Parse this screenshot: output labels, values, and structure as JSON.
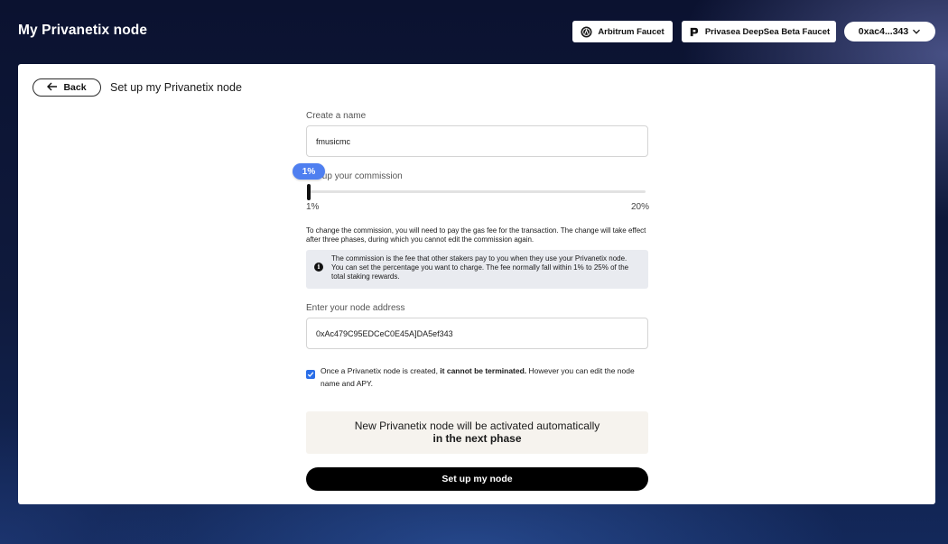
{
  "header": {
    "title": "My Privanetix node",
    "faucets": [
      {
        "label": "Arbitrum Faucet",
        "icon": "arbitrum-logo-icon"
      },
      {
        "label": "Privasea DeepSea Beta Faucet",
        "icon": "privasea-logo-icon"
      }
    ],
    "wallet": {
      "address": "0xac4...343",
      "icon": "chevron-down-icon"
    }
  },
  "card": {
    "back_label": "Back",
    "heading": "Set up my Privanetix node"
  },
  "form": {
    "name": {
      "label": "Create a name",
      "value": "fmusicmc"
    },
    "commission": {
      "label": "Set up your commission",
      "current": "1%",
      "current_value": 1,
      "min_label": "1%",
      "max_label": "20%",
      "min": 1,
      "max": 20
    },
    "commission_note": "To change the commission, you will need to pay the gas fee for the transaction. The change will take effect after three phases, during which you cannot edit the commission again.",
    "info_text": "The commission is the fee that other stakers pay to you when they use your Privanetix node. You can set the percentage you want to charge. The fee normally fall within 1% to 25% of the total staking rewards.",
    "address": {
      "label": "Enter your node address",
      "value": "0xAc479C95EDCeC0E45A]DA5ef343"
    },
    "consent": {
      "checked": true,
      "text_before": "Once a Privanetix node is created, ",
      "text_bold": "it cannot be terminated.",
      "text_after": " However you can edit the node name and APY."
    },
    "activation": {
      "line1": "New Privanetix node will be activated automatically",
      "line2": "in the next phase"
    },
    "submit_label": "Set up my node"
  },
  "colors": {
    "accent": "#4f7ff0",
    "checkbox": "#2a6ee8",
    "background_top": "#0b1230",
    "info_bg": "#e9ebf0",
    "activation_bg": "#f6f3ee"
  }
}
